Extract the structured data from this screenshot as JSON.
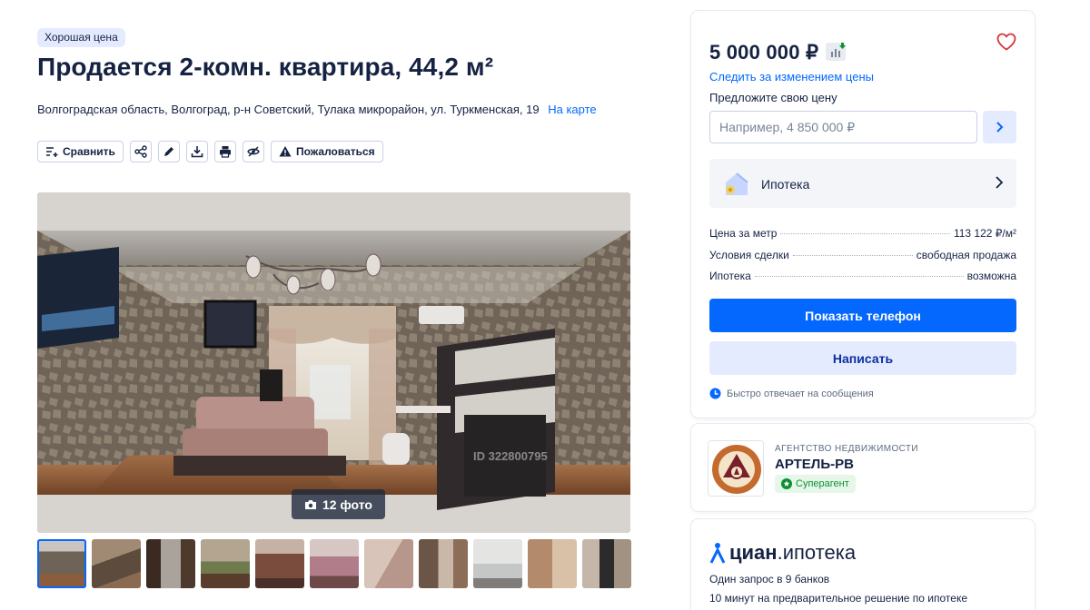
{
  "badge": "Хорошая цена",
  "title": "Продается 2-комн. квартира, 44,2 м²",
  "address": {
    "text": "Волгоградская область, Волгоград, р-н Советский, Тулака микрорайон, ул. Туркменская, 19",
    "map_link": "На карте"
  },
  "toolbar": {
    "compare_label": "Сравнить",
    "report_label": "Пожаловаться",
    "icons": [
      "compare-icon",
      "share-icon",
      "edit-icon",
      "download-icon",
      "print-icon",
      "hide-icon",
      "warning-icon"
    ]
  },
  "gallery": {
    "photo_count": "12 фото",
    "watermark": "ID 322800795",
    "thumbnail_count": 11
  },
  "sidebar": {
    "price": "5 000 000 ₽",
    "watch_price": "Следить за изменением цены",
    "offer_label": "Предложите свою цену",
    "offer_placeholder": "Например, 4 850 000 ₽",
    "mortgage_label": "Ипотека",
    "facts": [
      {
        "label": "Цена за метр",
        "value": "113 122 ₽/м²"
      },
      {
        "label": "Условия сделки",
        "value": "свободная продажа"
      },
      {
        "label": "Ипотека",
        "value": "возможна"
      }
    ],
    "show_phone": "Показать телефон",
    "write": "Написать",
    "reply_note": "Быстро отвечает на сообщения"
  },
  "agency": {
    "type": "АГЕНТСТВО НЕДВИЖИМОСТИ",
    "name": "АРТЕЛЬ-РВ",
    "badge": "Суперагент"
  },
  "ipoteka": {
    "logo_bold": "циан",
    "logo_rest": ".ипотека",
    "line1": "Один запрос в 9 банков",
    "line2": "10 минут на предварительное решение по ипотеке"
  },
  "colors": {
    "accent": "#0468ff",
    "text": "#152242",
    "badge_bg": "#e4ebff",
    "success": "#0d8f34"
  }
}
